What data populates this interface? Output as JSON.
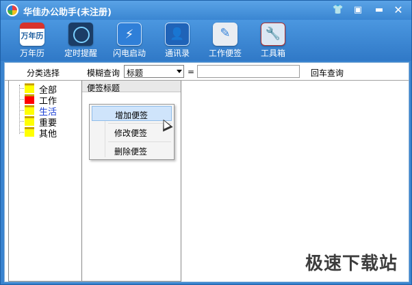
{
  "window": {
    "title": "华佳办公助手(未注册)"
  },
  "title_buttons": {
    "skin": "👕",
    "menu": "▣",
    "minimize": "▬",
    "close": "✕"
  },
  "toolbar": {
    "items": [
      {
        "label": "万年历",
        "icon_text": "万年历"
      },
      {
        "label": "定时提醒"
      },
      {
        "label": "闪电启动",
        "icon_text": "⚡"
      },
      {
        "label": "通讯录",
        "icon_text": "👤"
      },
      {
        "label": "工作便签",
        "icon_text": "✎"
      },
      {
        "label": "工具箱",
        "icon_text": "🔧"
      }
    ]
  },
  "filter": {
    "category_header": "分类选择",
    "fuzzy_label": "模糊查询",
    "field_selected": "标题",
    "equals": "=",
    "search_value": "",
    "enter_query": "回车查询"
  },
  "tree": {
    "items": [
      {
        "label": "全部",
        "color": "#ffff00"
      },
      {
        "label": "工作",
        "color": "#ff0000"
      },
      {
        "label": "生活",
        "color": "#ffff00"
      },
      {
        "label": "重要",
        "color": "#ffff00"
      },
      {
        "label": "其他",
        "color": "#ffff00"
      }
    ]
  },
  "notes": {
    "column_header": "便签标题"
  },
  "context_menu": {
    "items": [
      "增加便签",
      "修改便签",
      "删除便签"
    ]
  },
  "watermark": "极速下载站"
}
